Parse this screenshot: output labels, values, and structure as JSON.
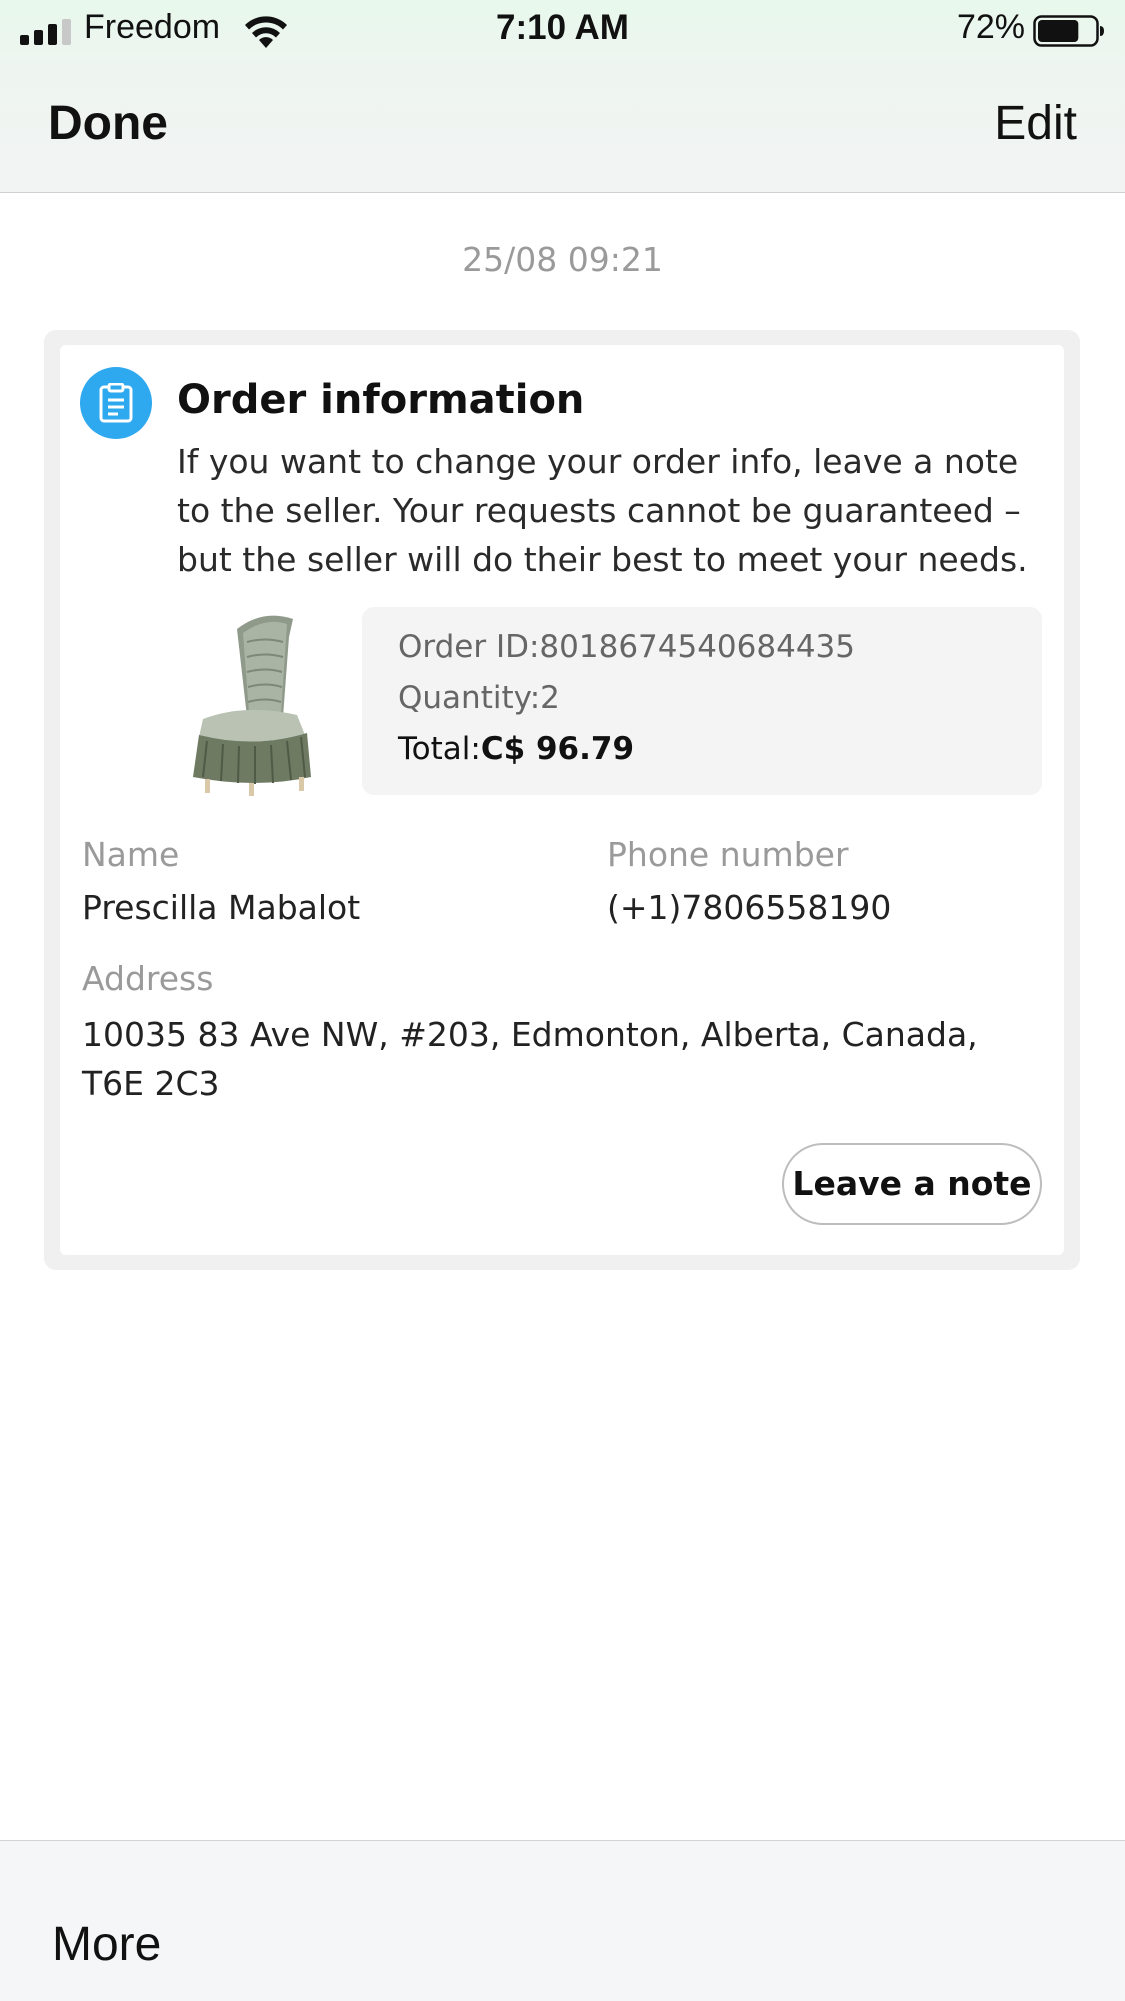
{
  "status_bar": {
    "carrier": "Freedom",
    "time": "7:10 AM",
    "battery_percent": "72%",
    "battery_level": 0.72
  },
  "nav": {
    "done_label": "Done",
    "edit_label": "Edit"
  },
  "message": {
    "timestamp": "25/08 09:21"
  },
  "card": {
    "icon": "clipboard-icon",
    "accent_color": "#2ea8ee",
    "title": "Order information",
    "description": "If you want to change your order info, leave a note to the seller. Your requests cannot be guaranteed – but the seller will do their best to meet your needs.",
    "order": {
      "order_id_label": "Order ID:",
      "order_id": "8018674540684435",
      "quantity_label": "Quantity:",
      "quantity": "2",
      "total_label": "Total:",
      "total": "C$ 96.79"
    },
    "name_label": "Name",
    "name": "Prescilla Mabalot",
    "phone_label": "Phone number",
    "phone": "(+1)7806558190",
    "address_label": "Address",
    "address": "10035 83 Ave NW, #203, Edmonton, Alberta, Canada, T6E 2C3",
    "leave_note_label": "Leave a note"
  },
  "bottom": {
    "more_label": "More"
  }
}
